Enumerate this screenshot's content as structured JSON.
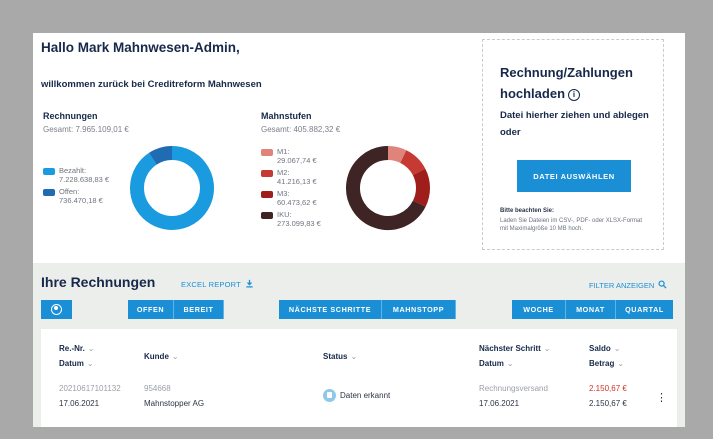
{
  "header": {
    "greeting": "Hallo Mark Mahnwesen-Admin,",
    "subtitle": "willkommen zurück bei Creditreform Mahnwesen"
  },
  "rechnungen": {
    "title": "Rechnungen",
    "total": "Gesamt: 7.965.109,01 €",
    "legend": [
      {
        "label": "Bezahlt:",
        "value": "7.228.638,83 €",
        "color": "#1a9be0"
      },
      {
        "label": "Offen:",
        "value": "736.470,18 €",
        "color": "#1f6cb3"
      }
    ],
    "chart_values": [
      7228638.83,
      736470.18
    ]
  },
  "mahnstufen": {
    "title": "Mahnstufen",
    "total": "Gesamt: 405.882,32 €",
    "legend": [
      {
        "label": "M1:",
        "value": "29.067,74 €",
        "color": "#e0837b"
      },
      {
        "label": "M2:",
        "value": "41.216,13 €",
        "color": "#c63a33"
      },
      {
        "label": "M3:",
        "value": "60.473,62 €",
        "color": "#9f1d1a"
      },
      {
        "label": "IKU:",
        "value": "273.099,83 €",
        "color": "#3e2424"
      }
    ],
    "chart_values": [
      29067.74,
      41216.13,
      60473.62,
      273099.83
    ]
  },
  "upload": {
    "title": "Rechnung/Zahlungen hochladen",
    "info_icon": "info-circle-icon",
    "drop_text": "Datei hierher ziehen und ablegen oder",
    "button_label": "DATEI AUSWÄHLEN",
    "note_title": "Bitte beachten Sie:",
    "note_body": "Laden Sie Dateien im CSV-, PDF- oder XLSX-Format mit Maximalgröße 10 MB hoch."
  },
  "invoices": {
    "title": "Ihre Rechnungen",
    "excel_label": "EXCEL REPORT",
    "excel_icon": "download-icon",
    "filter_label": "FILTER ANZEIGEN",
    "filter_icon": "search-icon",
    "user_icon": "user-icon",
    "tabs": {
      "offen": "OFFEN",
      "bereit": "BEREIT",
      "schritte": "NÄCHSTE SCHRITTE",
      "mahnstopp": "MAHNSTOPP",
      "woche": "WOCHE",
      "monat": "MONAT",
      "quartal": "QUARTAL"
    },
    "columns": {
      "renr": "Re.-Nr.",
      "datum": "Datum",
      "kunde": "Kunde",
      "status": "Status",
      "naechster": "Nächster Schritt",
      "datum2": "Datum",
      "saldo": "Saldo",
      "betrag": "Betrag"
    },
    "row": {
      "renr": "20210617101132",
      "datum": "17.06.2021",
      "kundennr": "954668",
      "kunde": "Mahnstopper AG",
      "status": "Daten erkannt",
      "naechster": "Rechnungsversand",
      "datum2": "17.06.2021",
      "saldo": "2.150,67 €",
      "betrag": "2.150,67 €"
    }
  }
}
